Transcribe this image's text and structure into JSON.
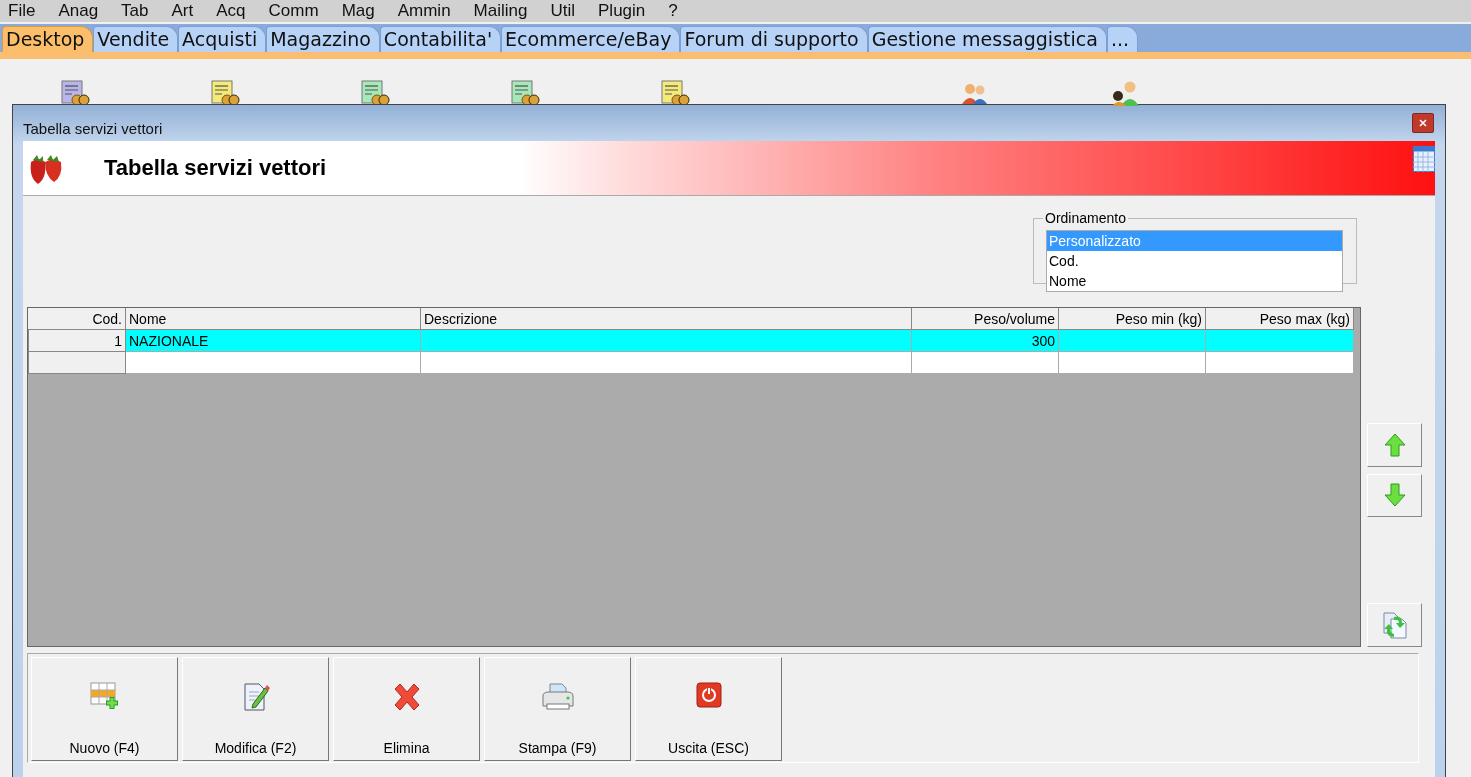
{
  "menu": [
    "File",
    "Anag",
    "Tab",
    "Art",
    "Acq",
    "Comm",
    "Mag",
    "Ammin",
    "Mailing",
    "Util",
    "Plugin",
    "?"
  ],
  "tabs": [
    {
      "label": "Desktop",
      "selected": true
    },
    {
      "label": "Vendite",
      "selected": false
    },
    {
      "label": "Acquisti",
      "selected": false
    },
    {
      "label": "Magazzino",
      "selected": false
    },
    {
      "label": "Contabilita'",
      "selected": false
    },
    {
      "label": "Ecommerce/eBay",
      "selected": false
    },
    {
      "label": "Forum di supporto",
      "selected": false
    },
    {
      "label": "Gestione messaggistica",
      "selected": false
    },
    {
      "label": "...",
      "selected": false
    }
  ],
  "window": {
    "title": "Tabella servizi vettori",
    "header": "Tabella servizi vettori"
  },
  "ordering": {
    "label": "Ordinamento",
    "options": [
      {
        "label": "Personalizzato",
        "selected": true
      },
      {
        "label": "Cod.",
        "selected": false
      },
      {
        "label": "Nome",
        "selected": false
      }
    ]
  },
  "table": {
    "columns": [
      "Cod.",
      "Nome",
      "Descrizione",
      "Peso/volume",
      "Peso min (kg)",
      "Peso max (kg)"
    ],
    "rows": [
      {
        "selected": true,
        "cells": [
          "1",
          "NAZIONALE",
          null,
          "300",
          null,
          null
        ]
      }
    ]
  },
  "buttons": [
    {
      "label": "Nuovo (F4)"
    },
    {
      "label": "Modifica (F2)"
    },
    {
      "label": "Elimina"
    },
    {
      "label": "Stampa (F9)"
    },
    {
      "label": "Uscita (ESC)"
    }
  ]
}
